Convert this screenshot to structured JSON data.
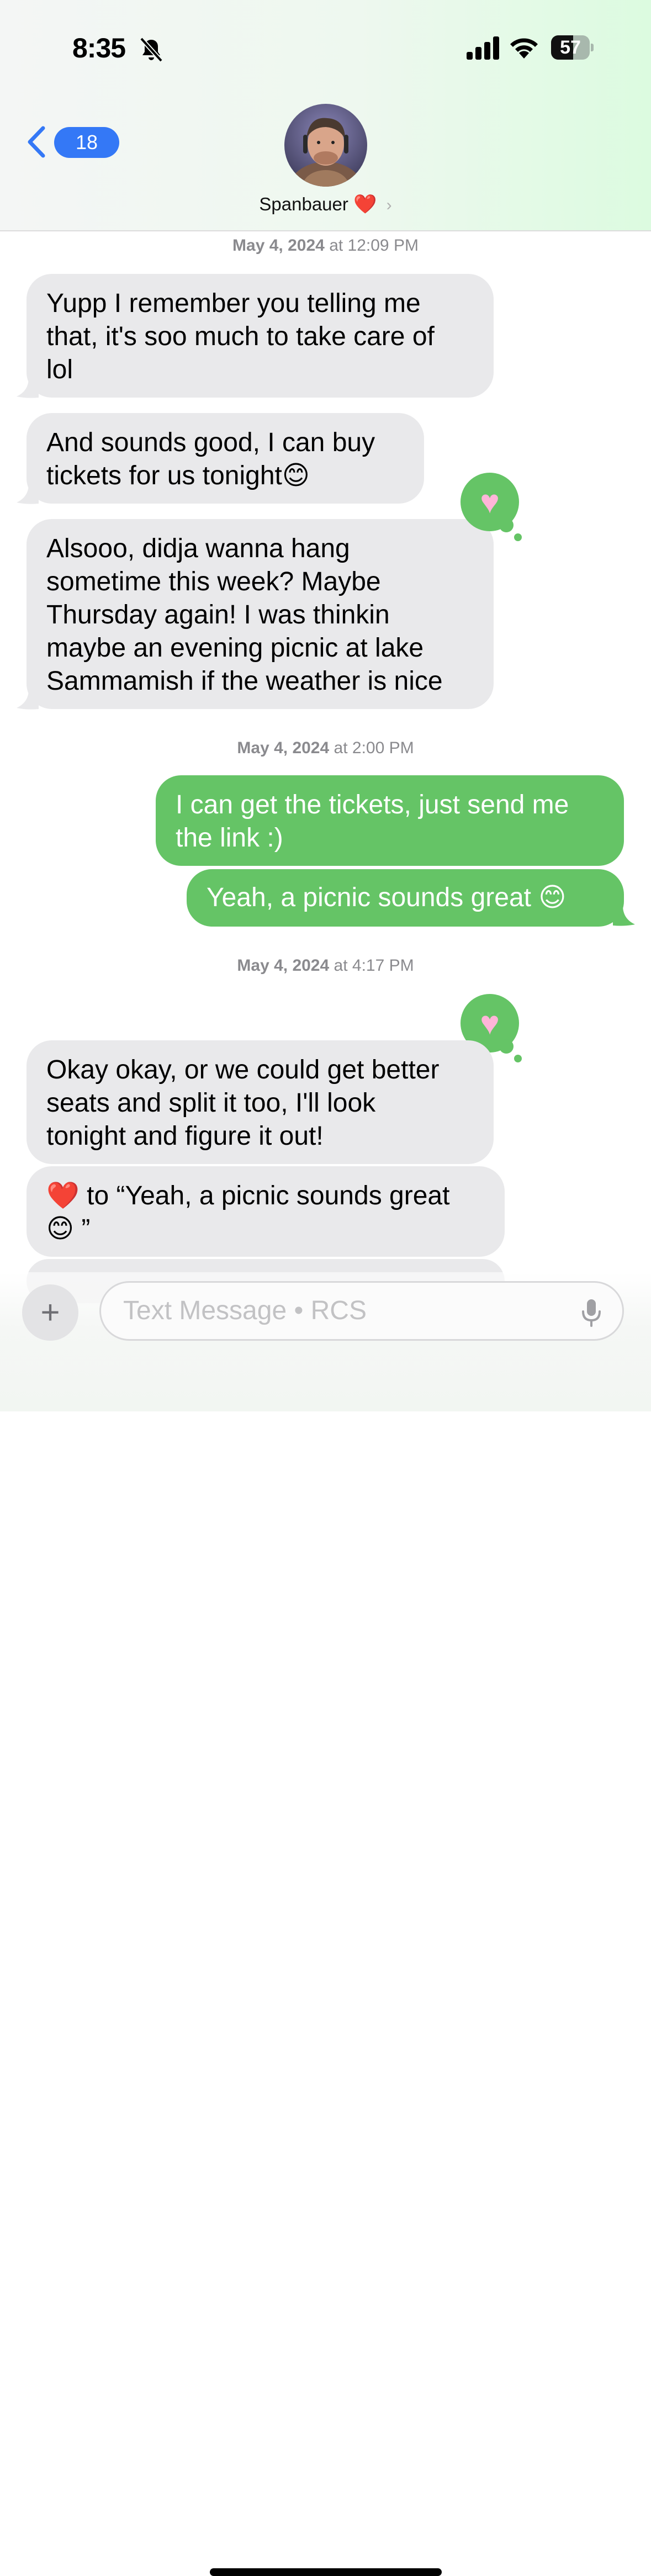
{
  "status_bar": {
    "time": "8:35",
    "battery": "57",
    "battery_level": 0.57
  },
  "header": {
    "back_count": "18",
    "contact_name": "Spanbauer",
    "contact_heart": "❤️",
    "contact_chevron": "›"
  },
  "messages": {
    "ts1_date": "May 4, 2024",
    "ts1_time": "at 12:09 PM",
    "m1": "Yupp I remember you telling me\nthat, it's soo much to take care of\nlol",
    "m2": "And sounds good, I can buy\ntickets for us tonight😊",
    "m3": "Alsooo, didja wanna hang\nsometime this week? Maybe\nThursday again! I was thinkin\nmaybe an evening picnic at lake\nSammamish if the weather is nice",
    "ts2_date": "May 4, 2024",
    "ts2_time": "at 2:00 PM",
    "m4": "I can get the tickets, just send me\nthe link :)",
    "m5": "Yeah, a picnic sounds great 😊",
    "ts3_date": "May 4, 2024",
    "ts3_time": "at 4:17 PM",
    "m6": "Okay okay, or we could get better\nseats and split it too, I'll look\ntonight and figure it out!",
    "m7": "❤️ to “Yeah, a picnic sounds great\n😊 ”",
    "tapback_glyph": "♥"
  },
  "composer": {
    "plus": "+",
    "placeholder": "Text Message • RCS"
  },
  "colors": {
    "sent": "#65c466",
    "received": "#e9e9eb",
    "accent": "#3478f6"
  }
}
